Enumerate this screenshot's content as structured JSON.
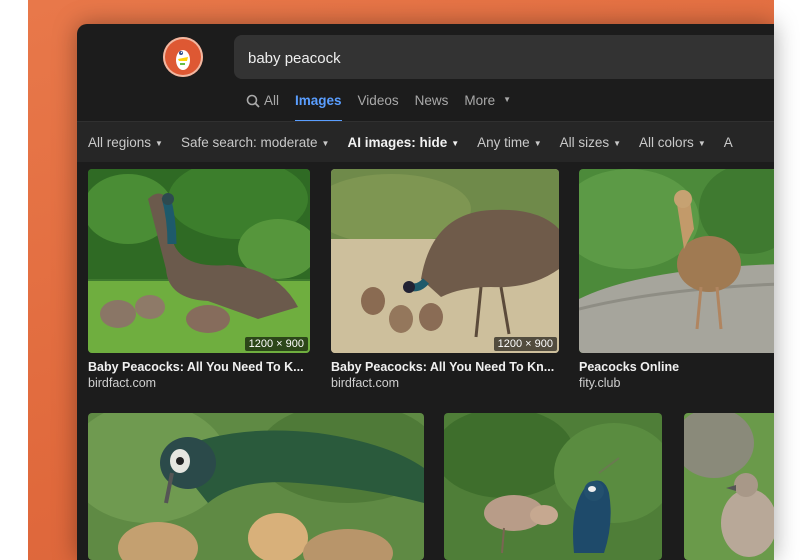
{
  "search": {
    "query": "baby peacock"
  },
  "tabs": [
    {
      "label": "All",
      "icon": "search-icon"
    },
    {
      "label": "Images"
    },
    {
      "label": "Videos"
    },
    {
      "label": "News"
    },
    {
      "label": "More"
    }
  ],
  "filters": [
    {
      "label": "All regions"
    },
    {
      "label": "Safe search: moderate"
    },
    {
      "label": "AI images: hide"
    },
    {
      "label": "Any time"
    },
    {
      "label": "All sizes"
    },
    {
      "label": "All colors"
    },
    {
      "label": "A"
    }
  ],
  "results": [
    {
      "title": "Baby Peacocks: All You Need To K...",
      "source": "birdfact.com",
      "dims": "1200 × 900"
    },
    {
      "title": "Baby Peacocks: All You Need To Kn...",
      "source": "birdfact.com",
      "dims": "1200 × 900"
    },
    {
      "title": "Peacocks Online",
      "source": "fity.club"
    }
  ],
  "colors": {
    "accent": "#5a9eff",
    "background": "#1c1c1c",
    "logo": "#de5833"
  }
}
